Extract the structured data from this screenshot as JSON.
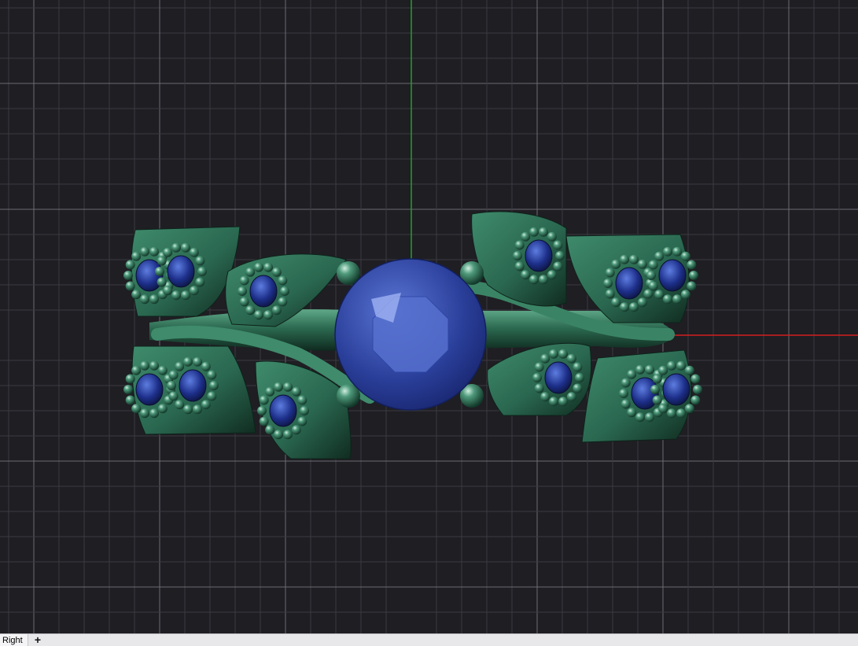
{
  "viewport": {
    "name": "Right",
    "background": "#1f1e23",
    "grid_minor_color": "#3a3a40",
    "grid_major_color": "#6b6b72",
    "axis_x_color": "#d31f1f",
    "axis_y_color": "#1fa02a"
  },
  "model": {
    "description_icon": "ring-model",
    "metal_color": "#2f6e55",
    "center_stone_color": "#2a3f9a",
    "accent_stone_color": "#1d2f8a"
  },
  "tabbar": {
    "active_tab_label": "Right",
    "add_tab_label": "+"
  }
}
